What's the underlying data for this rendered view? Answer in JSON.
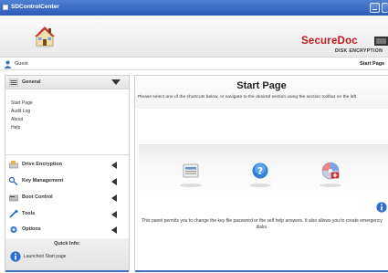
{
  "window": {
    "title": "SDControlCenter"
  },
  "brand": {
    "name": "SecureDoc",
    "subtitle": "DISK ENCRYPTION"
  },
  "user": {
    "name": "Guest"
  },
  "header": {
    "page_label": "Start Page"
  },
  "sidebar": {
    "general": {
      "label": "General",
      "icon": "list-icon",
      "links": [
        "Start Page",
        "Audit Log",
        "About",
        "Help"
      ]
    },
    "sections": [
      {
        "label": "Drive Encryption",
        "icon": "drive-encryption-icon"
      },
      {
        "label": "Key Management",
        "icon": "key-icon"
      },
      {
        "label": "Boot Control",
        "icon": "boot-control-icon"
      },
      {
        "label": "Tools",
        "icon": "tools-icon"
      },
      {
        "label": "Options",
        "icon": "options-gear-icon"
      }
    ],
    "quick_info": {
      "title": "Quick Info:",
      "text": "Launched Start page"
    }
  },
  "main": {
    "title": "Start Page",
    "description": "Please select one of the shortcuts below, or navigate to the desired section using the section toolbar on the left.",
    "shortcuts": [
      {
        "icon": "drive-shortcut-icon"
      },
      {
        "icon": "help-shortcut-icon"
      },
      {
        "icon": "emergency-disk-shortcut-icon"
      }
    ],
    "info_text": "This panel permits you to change the key file password or the self help answers. It also allows you to create emergency disks."
  },
  "colors": {
    "titlebar": "#2b5bb5",
    "brand_red": "#c4161c",
    "accent_blue": "#3d6bc2"
  }
}
